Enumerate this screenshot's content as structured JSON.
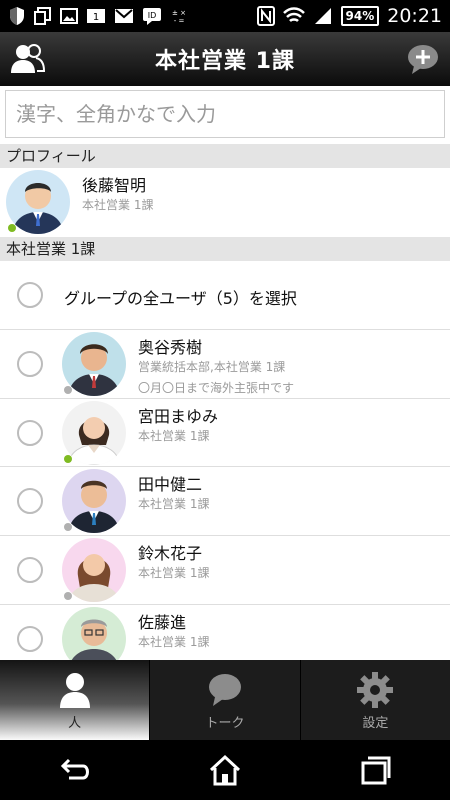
{
  "status_bar": {
    "battery": "94%",
    "time": "20:21"
  },
  "header": {
    "title": "本社営業 1課"
  },
  "search": {
    "placeholder": "漢字、全角かなで入力"
  },
  "sections": {
    "profile_label": "プロフィール",
    "group_label": "本社営業 1課"
  },
  "profile": {
    "name": "後藤智明",
    "dept": "本社営業 1課",
    "status": "online"
  },
  "group_select": {
    "label": "グループの全ユーザ（5）を選択"
  },
  "members": [
    {
      "name": "奥谷秀樹",
      "dept": "営業統括本部,本社営業 1課",
      "note": "〇月〇日まで海外主張中です",
      "status": "away"
    },
    {
      "name": "宮田まゆみ",
      "dept": "本社営業 1課",
      "note": "",
      "status": "online"
    },
    {
      "name": "田中健二",
      "dept": "本社営業 1課",
      "note": "",
      "status": "away"
    },
    {
      "name": "鈴木花子",
      "dept": "本社営業 1課",
      "note": "",
      "status": "away"
    },
    {
      "name": "佐藤進",
      "dept": "本社営業 1課",
      "note": "",
      "status": "away"
    }
  ],
  "tabs": [
    {
      "label": "人",
      "icon": "person-icon",
      "active": true
    },
    {
      "label": "トーク",
      "icon": "chat-bubble-icon",
      "active": false
    },
    {
      "label": "設定",
      "icon": "gear-icon",
      "active": false
    }
  ],
  "colors": {
    "online": "#7fbb22",
    "away": "#b0b0b0",
    "section_bg": "#e4e4e4",
    "header_dark": "#0b0b0b"
  }
}
